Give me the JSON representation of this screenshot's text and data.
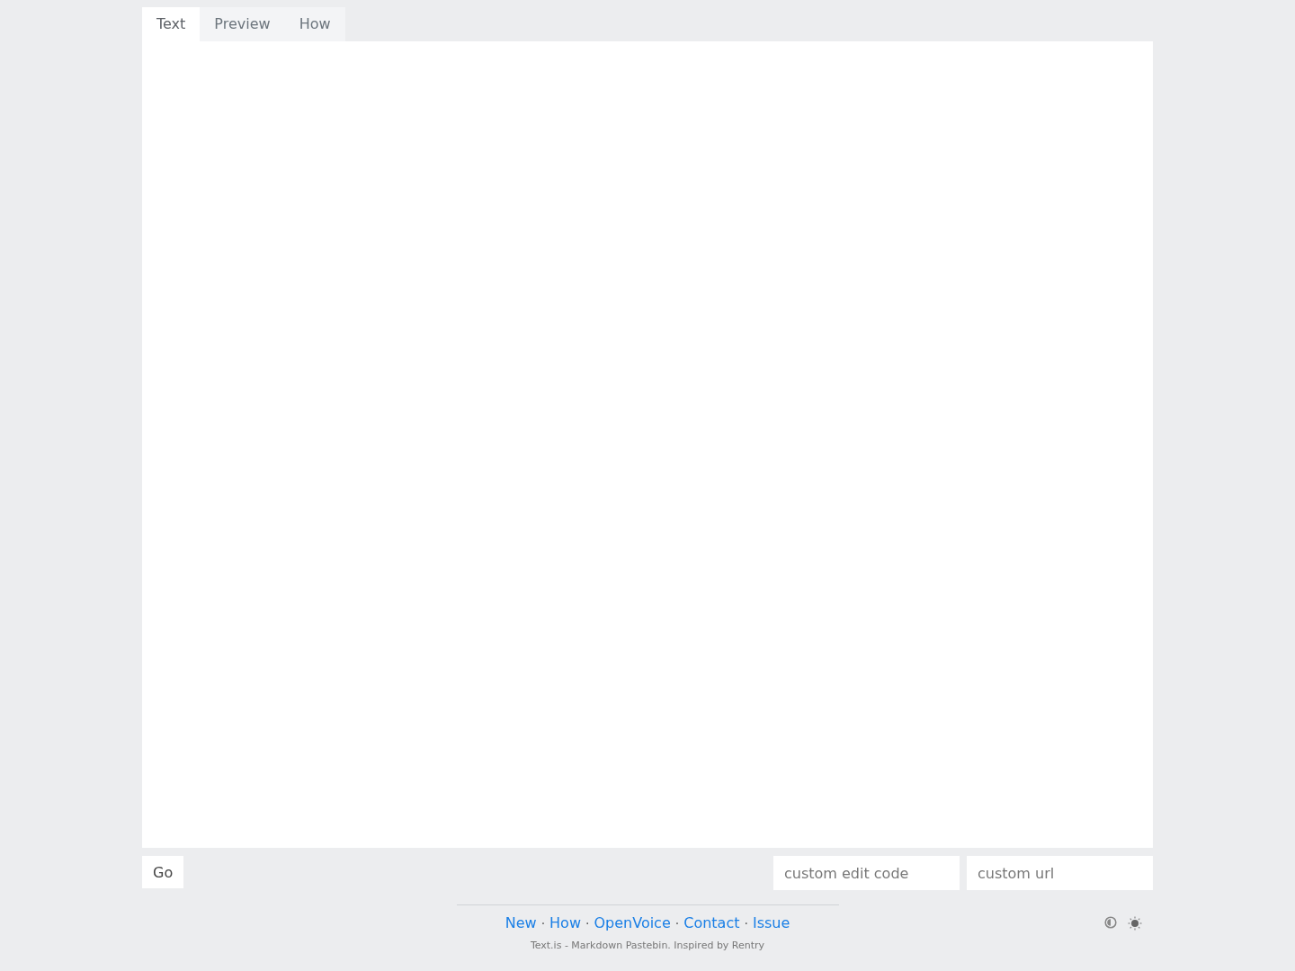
{
  "tabs": [
    {
      "label": "Text",
      "selected": true
    },
    {
      "label": "Preview",
      "selected": false
    },
    {
      "label": "How",
      "selected": false
    }
  ],
  "go_button": "Go",
  "fields": [
    {
      "placeholder": "custom edit code"
    },
    {
      "placeholder": "custom url"
    }
  ],
  "footer": {
    "nav": [
      {
        "kind": "link",
        "text": "New"
      },
      {
        "kind": "separator",
        "text": "·"
      },
      {
        "kind": "link",
        "text": "How"
      },
      {
        "kind": "separator",
        "text": "·"
      },
      {
        "kind": "link",
        "text": "OpenVoice"
      },
      {
        "kind": "separator",
        "text": "·"
      },
      {
        "kind": "link",
        "text": "Contact"
      },
      {
        "kind": "separator",
        "text": "·"
      },
      {
        "kind": "link",
        "text": "Issue"
      }
    ],
    "credit": "Text.is - Markdown Pastebin. Inspired by Rentry"
  }
}
